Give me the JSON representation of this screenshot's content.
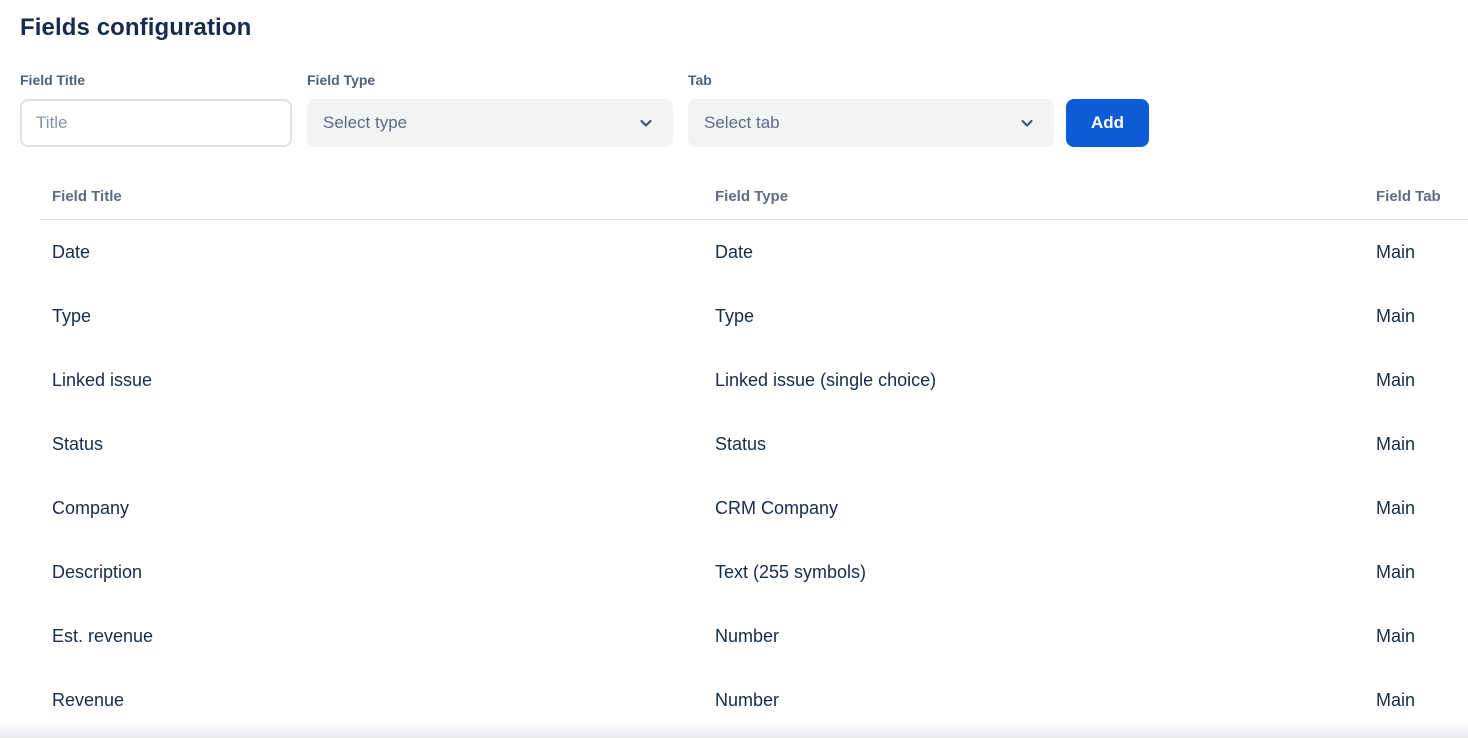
{
  "page": {
    "title": "Fields configuration"
  },
  "form": {
    "title_field": {
      "label": "Field Title",
      "placeholder": "Title",
      "value": ""
    },
    "type_field": {
      "label": "Field Type",
      "selected": "Select type"
    },
    "tab_field": {
      "label": "Tab",
      "selected": "Select tab"
    },
    "add_label": "Add"
  },
  "table": {
    "headers": [
      "Field Title",
      "Field Type",
      "Field Tab"
    ],
    "rows": [
      {
        "title": "Date",
        "type": "Date",
        "tab": "Main"
      },
      {
        "title": "Type",
        "type": "Type",
        "tab": "Main"
      },
      {
        "title": "Linked issue",
        "type": "Linked issue (single choice)",
        "tab": "Main"
      },
      {
        "title": "Status",
        "type": "Status",
        "tab": "Main"
      },
      {
        "title": "Company",
        "type": "CRM Company",
        "tab": "Main"
      },
      {
        "title": "Description",
        "type": "Text (255 symbols)",
        "tab": "Main"
      },
      {
        "title": "Est. revenue",
        "type": "Number",
        "tab": "Main"
      },
      {
        "title": "Revenue",
        "type": "Number",
        "tab": "Main"
      }
    ]
  },
  "icons": {
    "chevron_down": "chevron-down"
  },
  "colors": {
    "accent_blue": "#0C5CD5",
    "heading_text": "#172B4D",
    "muted_label": "#505F79",
    "table_header_text": "#5E6C84",
    "placeholder_text": "#8993A4",
    "control_background": "#F2F3F5",
    "border": "#DFE1E6"
  }
}
